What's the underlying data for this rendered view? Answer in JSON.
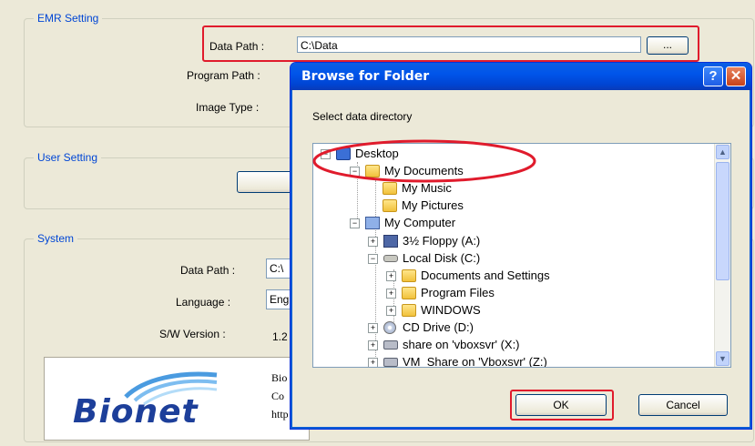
{
  "emr": {
    "title": "EMR Setting",
    "data_path_label": "Data Path :",
    "data_path_value": "C:\\Data",
    "browse_label": "...",
    "program_path_label": "Program Path :",
    "image_type_label": "Image Type :"
  },
  "user": {
    "title": "User Setting"
  },
  "system": {
    "title": "System",
    "data_path_label": "Data Path :",
    "data_path_value": "C:\\",
    "language_label": "Language :",
    "language_value": "Eng",
    "sw_version_label": "S/W Version :",
    "sw_version_value": "1.2"
  },
  "about": {
    "logo_text": "Bionet",
    "line1": "Bio",
    "line2": "Co",
    "line3": "http"
  },
  "dialog": {
    "title": "Browse for Folder",
    "help_glyph": "?",
    "close_glyph": "✕",
    "prompt": "Select data directory",
    "tree": [
      {
        "label": "Desktop",
        "icon": "desktop-icon",
        "expander": "−"
      },
      {
        "label": "My Documents",
        "icon": "my-documents-icon",
        "expander": "−"
      },
      {
        "label": "My Music",
        "icon": "music-folder-icon",
        "expander": ""
      },
      {
        "label": "My Pictures",
        "icon": "pictures-folder-icon",
        "expander": ""
      },
      {
        "label": "My Computer",
        "icon": "computer-icon",
        "expander": "−"
      },
      {
        "label": "3½ Floppy (A:)",
        "icon": "floppy-icon",
        "expander": "+"
      },
      {
        "label": "Local Disk (C:)",
        "icon": "hard-drive-icon",
        "expander": "−"
      },
      {
        "label": "Documents and Settings",
        "icon": "folder-icon",
        "expander": "+"
      },
      {
        "label": "Program Files",
        "icon": "folder-icon",
        "expander": "+"
      },
      {
        "label": "WINDOWS",
        "icon": "folder-icon",
        "expander": "+"
      },
      {
        "label": "CD Drive (D:)",
        "icon": "cd-drive-icon",
        "expander": "+"
      },
      {
        "label": "share on 'vboxsvr' (X:)",
        "icon": "network-drive-icon",
        "expander": "+"
      },
      {
        "label": "VM_Share on 'Vboxsvr' (Z:)",
        "icon": "network-drive-icon",
        "expander": "+"
      }
    ],
    "ok_label": "OK",
    "cancel_label": "Cancel"
  },
  "colors": {
    "highlight": "#e01b2c",
    "title_bar": "#0055ea"
  }
}
